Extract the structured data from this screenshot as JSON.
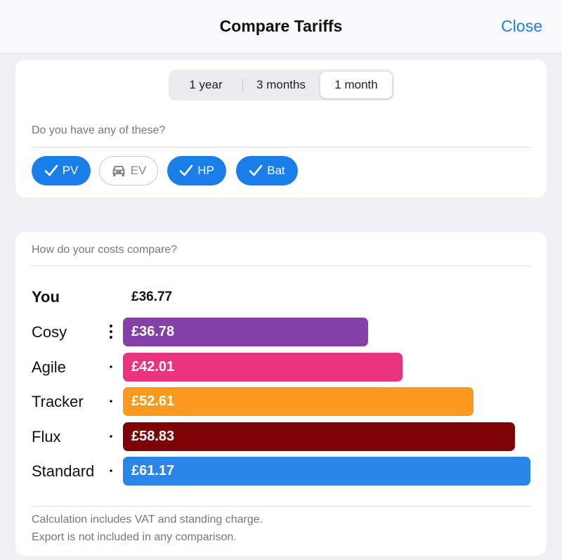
{
  "header": {
    "title": "Compare Tariffs",
    "close_label": "Close"
  },
  "period": {
    "options": [
      "1 year",
      "3 months",
      "1 month"
    ],
    "selected": "1 month"
  },
  "assets": {
    "question": "Do you have any of these?",
    "chips": [
      {
        "label": "PV",
        "checked": true,
        "icon": "checkmark-icon"
      },
      {
        "label": "EV",
        "checked": false,
        "icon": "car-icon"
      },
      {
        "label": "HP",
        "checked": true,
        "icon": "checkmark-icon"
      },
      {
        "label": "Bat",
        "checked": true,
        "icon": "checkmark-icon"
      }
    ]
  },
  "comparison": {
    "question": "How do your costs compare?",
    "you": {
      "label": "You",
      "value": "£36.77"
    },
    "tariffs": [
      {
        "name": "Cosy",
        "value": "£36.78",
        "amount": 36.78,
        "color": "#8440a6"
      },
      {
        "name": "Agile",
        "value": "£42.01",
        "amount": 42.01,
        "color": "#e8337f"
      },
      {
        "name": "Tracker",
        "value": "£52.61",
        "amount": 52.61,
        "color": "#f99a1f"
      },
      {
        "name": "Flux",
        "value": "£58.83",
        "amount": 58.83,
        "color": "#7d0306"
      },
      {
        "name": "Standard",
        "value": "£61.17",
        "amount": 61.17,
        "color": "#2a85e8"
      }
    ],
    "footnote_1": "Calculation includes VAT and standing charge.",
    "footnote_2": "Export is not included in any comparison."
  }
}
